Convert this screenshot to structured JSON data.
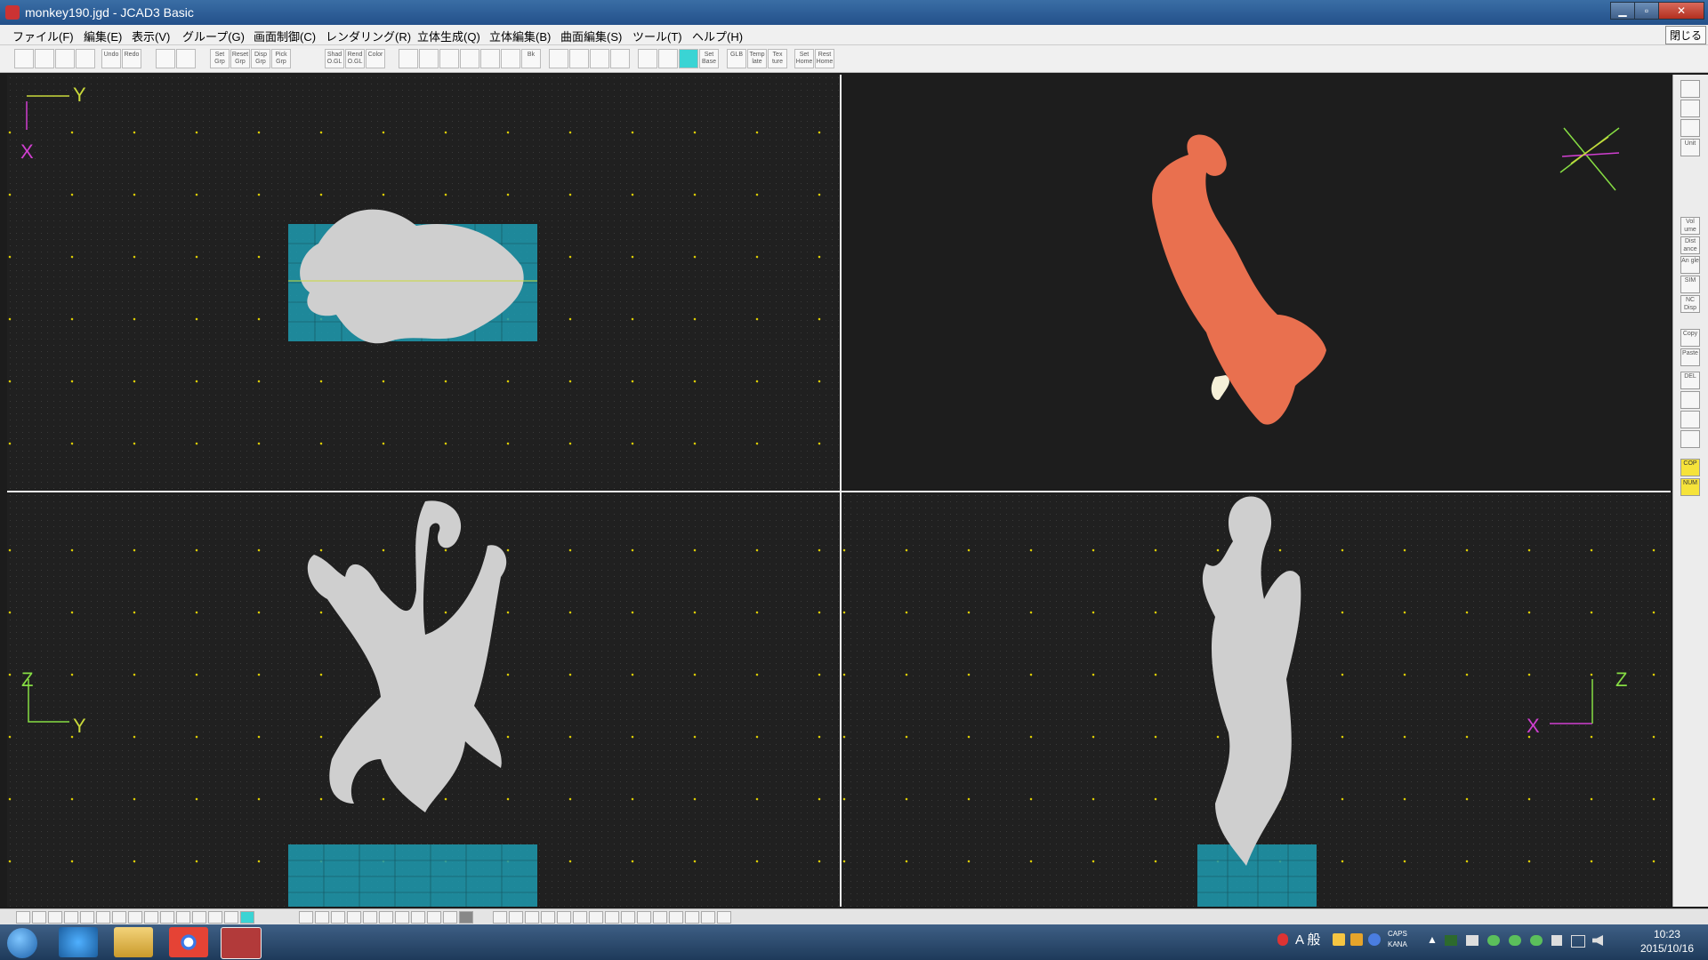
{
  "window": {
    "title": "monkey190.jgd - JCAD3 Basic",
    "minimize_glyph": "▁",
    "maximize_glyph": "▫",
    "close_glyph": "✕"
  },
  "menubar": {
    "items": [
      "ファイル(F)",
      "編集(E)",
      "表示(V)",
      "グループ(G)",
      "画面制御(C)",
      "レンダリング(R)",
      "立体生成(Q)",
      "立体編集(B)",
      "曲面編集(S)",
      "ツール(T)",
      "ヘルプ(H)"
    ],
    "close_label": "閉じる"
  },
  "toolbar": {
    "buttons": [
      {
        "label": "",
        "icon": "new-file-icon"
      },
      {
        "label": "",
        "icon": "open-folder-icon"
      },
      {
        "label": "",
        "icon": "save-icon"
      },
      {
        "label": "",
        "icon": "print-icon"
      },
      {
        "label": "Undo",
        "icon": "undo-icon"
      },
      {
        "label": "Redo",
        "icon": "redo-icon"
      },
      {
        "label": "",
        "icon": "grid-view-icon"
      },
      {
        "label": "",
        "icon": "layout-icon"
      },
      {
        "label": "Set Grp",
        "icon": "set-group-icon"
      },
      {
        "label": "Reset Grp",
        "icon": "reset-group-icon"
      },
      {
        "label": "Disp Grp",
        "icon": "display-group-icon"
      },
      {
        "label": "Pick Grp",
        "icon": "pick-group-icon"
      },
      {
        "label": "Shad O.GL",
        "icon": "shade-opengl-icon"
      },
      {
        "label": "Rend O.GL",
        "icon": "render-opengl-icon"
      },
      {
        "label": "Color",
        "icon": "color-icon"
      },
      {
        "label": "",
        "icon": "zoom-in-icon"
      },
      {
        "label": "",
        "icon": "zoom-out-icon"
      },
      {
        "label": "",
        "icon": "zoom-fit-icon"
      },
      {
        "label": "",
        "icon": "zoom-window-icon"
      },
      {
        "label": "",
        "icon": "zoom-area-icon"
      },
      {
        "label": "",
        "icon": "pan-hand-icon"
      },
      {
        "label": "Bk",
        "icon": "back-view-icon"
      },
      {
        "label": "",
        "icon": "zoom-rect-icon"
      },
      {
        "label": "",
        "icon": "zoom-prev-icon"
      },
      {
        "label": "",
        "icon": "zoom-all-icon"
      },
      {
        "label": "",
        "icon": "redraw-icon"
      },
      {
        "label": "",
        "icon": "grid-dots-icon"
      },
      {
        "label": "",
        "icon": "grid-snap-icon"
      },
      {
        "label": "",
        "icon": "grid-active-icon"
      },
      {
        "label": "Set Base",
        "icon": "set-base-icon"
      },
      {
        "label": "GLB",
        "icon": "global-icon"
      },
      {
        "label": "Temp late",
        "icon": "template-icon"
      },
      {
        "label": "Tex ture",
        "icon": "texture-icon"
      },
      {
        "label": "Set Home",
        "icon": "set-home-icon"
      },
      {
        "label": "Rest Home",
        "icon": "restore-home-icon"
      }
    ]
  },
  "viewports": {
    "top": {
      "axis_h": "Y",
      "axis_v": "X"
    },
    "perspective": {},
    "front": {
      "axis_h": "Y",
      "axis_v": "Z"
    },
    "side": {
      "axis_h": "X",
      "axis_v": "Z"
    }
  },
  "rightbar": {
    "buttons": [
      "",
      "",
      "",
      "Unit",
      "Vol ume",
      "Dist ance",
      "An gle",
      "SIM",
      "NC Disp",
      "Copy",
      "Paste",
      "DEL",
      "",
      "",
      "",
      "COP",
      "NUM"
    ]
  },
  "taskbar": {
    "tray_ime": "A 般",
    "caps": "CAPS",
    "kana": "KANA",
    "time": "10:23",
    "date": "2015/10/16"
  },
  "colors": {
    "model_wire": "#cfcfcf",
    "model_render": "#e9704f",
    "grid_base": "#1f9bb0",
    "axis_x": "#d03fd0",
    "axis_y": "#c8d83a",
    "axis_z": "#86dd43"
  }
}
